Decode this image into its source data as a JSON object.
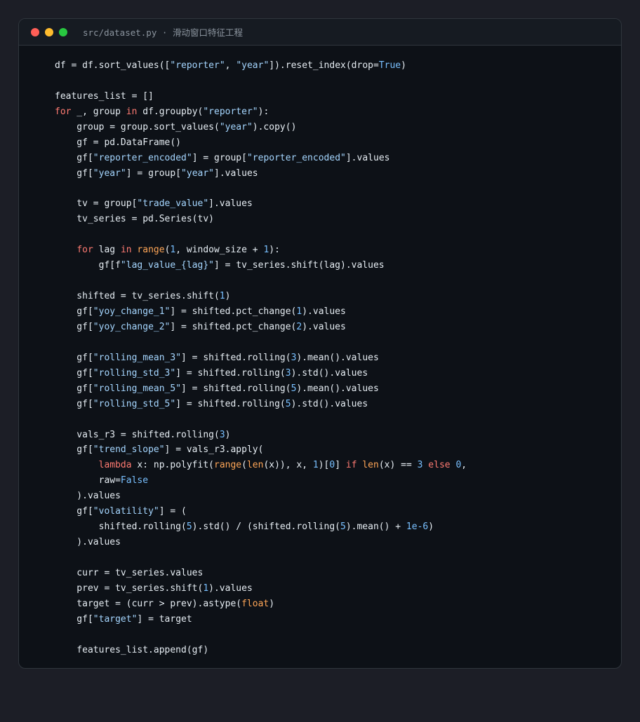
{
  "window": {
    "title": "src/dataset.py",
    "separator": " · ",
    "subtitle": "滑动窗口特征工程",
    "traffic_lights": {
      "close": "#ff5f57",
      "minimize": "#febc2e",
      "maximize": "#28c840"
    }
  },
  "theme": {
    "background": "#0d1117",
    "keyword": "#ff7b72",
    "string": "#a5d6ff",
    "number": "#79c0ff",
    "builtin": "#ffa657",
    "text": "#e6edf3"
  },
  "code_lines": [
    [
      [
        "t",
        "df = df.sort_values(["
      ],
      [
        "s",
        "\"reporter\""
      ],
      [
        "t",
        ", "
      ],
      [
        "s",
        "\"year\""
      ],
      [
        "t",
        "]).reset_index(drop="
      ],
      [
        "n",
        "True"
      ],
      [
        "t",
        ")"
      ]
    ],
    [],
    [
      [
        "t",
        "features_list = []"
      ]
    ],
    [
      [
        "k",
        "for"
      ],
      [
        "t",
        " _, group "
      ],
      [
        "k",
        "in"
      ],
      [
        "t",
        " df.groupby("
      ],
      [
        "s",
        "\"reporter\""
      ],
      [
        "t",
        "):"
      ]
    ],
    [
      [
        "t",
        "    group = group.sort_values("
      ],
      [
        "s",
        "\"year\""
      ],
      [
        "t",
        ").copy()"
      ]
    ],
    [
      [
        "t",
        "    gf = pd.DataFrame()"
      ]
    ],
    [
      [
        "t",
        "    gf["
      ],
      [
        "s",
        "\"reporter_encoded\""
      ],
      [
        "t",
        "] = group["
      ],
      [
        "s",
        "\"reporter_encoded\""
      ],
      [
        "t",
        "].values"
      ]
    ],
    [
      [
        "t",
        "    gf["
      ],
      [
        "s",
        "\"year\""
      ],
      [
        "t",
        "] = group["
      ],
      [
        "s",
        "\"year\""
      ],
      [
        "t",
        "].values"
      ]
    ],
    [],
    [
      [
        "t",
        "    tv = group["
      ],
      [
        "s",
        "\"trade_value\""
      ],
      [
        "t",
        "].values"
      ]
    ],
    [
      [
        "t",
        "    tv_series = pd.Series(tv)"
      ]
    ],
    [],
    [
      [
        "t",
        "    "
      ],
      [
        "k",
        "for"
      ],
      [
        "t",
        " lag "
      ],
      [
        "k",
        "in"
      ],
      [
        "t",
        " "
      ],
      [
        "b",
        "range"
      ],
      [
        "t",
        "("
      ],
      [
        "n",
        "1"
      ],
      [
        "t",
        ", window_size + "
      ],
      [
        "n",
        "1"
      ],
      [
        "t",
        "):"
      ]
    ],
    [
      [
        "t",
        "        gf[f"
      ],
      [
        "s",
        "\"lag_value_{lag}\""
      ],
      [
        "t",
        "] = tv_series.shift(lag).values"
      ]
    ],
    [],
    [
      [
        "t",
        "    shifted = tv_series.shift("
      ],
      [
        "n",
        "1"
      ],
      [
        "t",
        ")"
      ]
    ],
    [
      [
        "t",
        "    gf["
      ],
      [
        "s",
        "\"yoy_change_1\""
      ],
      [
        "t",
        "] = shifted.pct_change("
      ],
      [
        "n",
        "1"
      ],
      [
        "t",
        ").values"
      ]
    ],
    [
      [
        "t",
        "    gf["
      ],
      [
        "s",
        "\"yoy_change_2\""
      ],
      [
        "t",
        "] = shifted.pct_change("
      ],
      [
        "n",
        "2"
      ],
      [
        "t",
        ").values"
      ]
    ],
    [],
    [
      [
        "t",
        "    gf["
      ],
      [
        "s",
        "\"rolling_mean_3\""
      ],
      [
        "t",
        "] = shifted.rolling("
      ],
      [
        "n",
        "3"
      ],
      [
        "t",
        ").mean().values"
      ]
    ],
    [
      [
        "t",
        "    gf["
      ],
      [
        "s",
        "\"rolling_std_3\""
      ],
      [
        "t",
        "] = shifted.rolling("
      ],
      [
        "n",
        "3"
      ],
      [
        "t",
        ").std().values"
      ]
    ],
    [
      [
        "t",
        "    gf["
      ],
      [
        "s",
        "\"rolling_mean_5\""
      ],
      [
        "t",
        "] = shifted.rolling("
      ],
      [
        "n",
        "5"
      ],
      [
        "t",
        ").mean().values"
      ]
    ],
    [
      [
        "t",
        "    gf["
      ],
      [
        "s",
        "\"rolling_std_5\""
      ],
      [
        "t",
        "] = shifted.rolling("
      ],
      [
        "n",
        "5"
      ],
      [
        "t",
        ").std().values"
      ]
    ],
    [],
    [
      [
        "t",
        "    vals_r3 = shifted.rolling("
      ],
      [
        "n",
        "3"
      ],
      [
        "t",
        ")"
      ]
    ],
    [
      [
        "t",
        "    gf["
      ],
      [
        "s",
        "\"trend_slope\""
      ],
      [
        "t",
        "] = vals_r3.apply("
      ]
    ],
    [
      [
        "t",
        "        "
      ],
      [
        "k",
        "lambda"
      ],
      [
        "t",
        " x: np.polyfit("
      ],
      [
        "b",
        "range"
      ],
      [
        "t",
        "("
      ],
      [
        "b",
        "len"
      ],
      [
        "t",
        "(x)), x, "
      ],
      [
        "n",
        "1"
      ],
      [
        "t",
        ")["
      ],
      [
        "n",
        "0"
      ],
      [
        "t",
        "] "
      ],
      [
        "k",
        "if"
      ],
      [
        "t",
        " "
      ],
      [
        "b",
        "len"
      ],
      [
        "t",
        "(x) == "
      ],
      [
        "n",
        "3"
      ],
      [
        "t",
        " "
      ],
      [
        "k",
        "else"
      ],
      [
        "t",
        " "
      ],
      [
        "n",
        "0"
      ],
      [
        "t",
        ","
      ]
    ],
    [
      [
        "t",
        "        raw="
      ],
      [
        "n",
        "False"
      ]
    ],
    [
      [
        "t",
        "    ).values"
      ]
    ],
    [
      [
        "t",
        "    gf["
      ],
      [
        "s",
        "\"volatility\""
      ],
      [
        "t",
        "] = ("
      ]
    ],
    [
      [
        "t",
        "        shifted.rolling("
      ],
      [
        "n",
        "5"
      ],
      [
        "t",
        ").std() / (shifted.rolling("
      ],
      [
        "n",
        "5"
      ],
      [
        "t",
        ").mean() + "
      ],
      [
        "n",
        "1e-6"
      ],
      [
        "t",
        ")"
      ]
    ],
    [
      [
        "t",
        "    ).values"
      ]
    ],
    [],
    [
      [
        "t",
        "    curr = tv_series.values"
      ]
    ],
    [
      [
        "t",
        "    prev = tv_series.shift("
      ],
      [
        "n",
        "1"
      ],
      [
        "t",
        ").values"
      ]
    ],
    [
      [
        "t",
        "    target = (curr > prev).astype("
      ],
      [
        "b",
        "float"
      ],
      [
        "t",
        ")"
      ]
    ],
    [
      [
        "t",
        "    gf["
      ],
      [
        "s",
        "\"target\""
      ],
      [
        "t",
        "] = target"
      ]
    ],
    [],
    [
      [
        "t",
        "    features_list.append(gf)"
      ]
    ]
  ]
}
